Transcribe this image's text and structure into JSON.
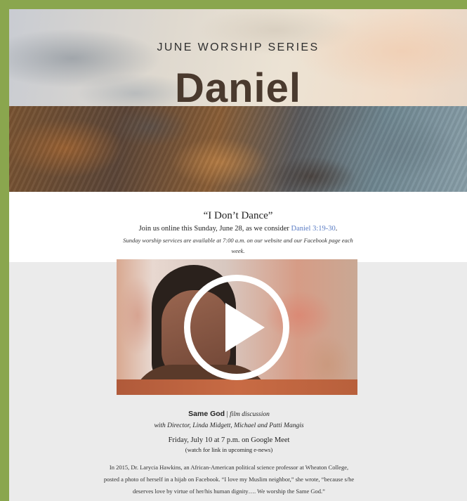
{
  "banner": {
    "series_title": "JUNE WORSHIP SERIES",
    "series_name": "Daniel"
  },
  "intro": {
    "title": "“I Don’t Dance”",
    "line_prefix": "Join us online this Sunday, June 28, as we consider ",
    "scripture_link": "Daniel 3:19-30",
    "line_suffix": ".",
    "note": "Sunday worship services are available at 7:00 a.m. on our website and our Facebook page each week."
  },
  "video": {
    "play_icon": "play-icon",
    "bar_color": "#c86b44"
  },
  "event": {
    "film_title": "Same God",
    "film_sep": " | ",
    "film_type": "film discussion",
    "with": "with Director, Linda Midgett, Michael and Patti Mangis",
    "when": "Friday, July 10 at 7 p.m. on Google Meet",
    "watch": "(watch for link in upcoming e-news)",
    "description": "In 2015, Dr. Larycia Hawkins, an African-American political science professor at Wheaton College, posted a photo of herself in a hijab on Facebook. “I love my Muslim neighbor,” she wrote, “because s/he deserves love by virtue of her/his human dignity…. We worship the Same God.”"
  },
  "colors": {
    "outer_border": "#8aa64e",
    "link": "#5a7cc4",
    "content_bg": "#ebebeb"
  }
}
